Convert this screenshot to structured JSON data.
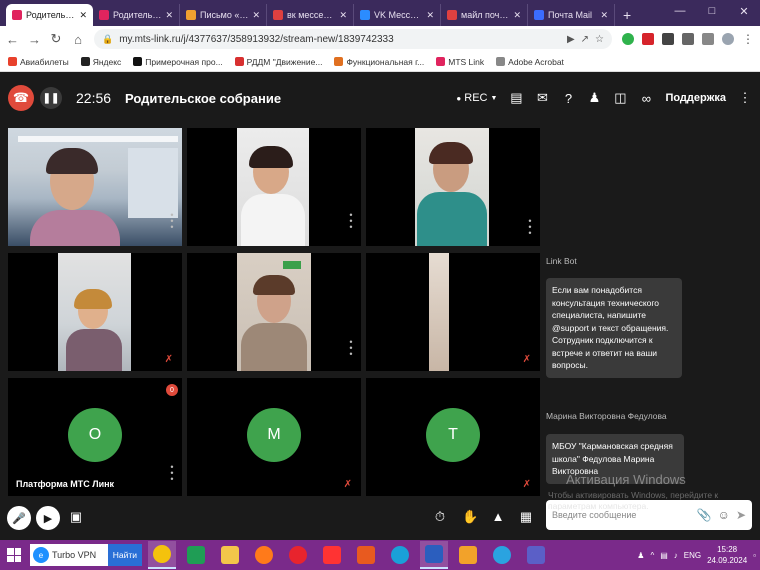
{
  "browser": {
    "tabs": [
      {
        "label": "Родительско",
        "favicon_color": "#e0245e",
        "active": true
      },
      {
        "label": "Родительское с",
        "favicon_color": "#e0245e",
        "active": false
      },
      {
        "label": "Письмо «(Без т",
        "favicon_color": "#f0a030",
        "active": false
      },
      {
        "label": "вк мессенджер",
        "favicon_color": "#e04040",
        "active": false
      },
      {
        "label": "VK Мессендже",
        "favicon_color": "#2b8cff",
        "active": false
      },
      {
        "label": "майл почта —",
        "favicon_color": "#e04040",
        "active": false
      },
      {
        "label": "Почта Mail",
        "favicon_color": "#3b6cff",
        "active": false
      }
    ],
    "new_tab_label": "+",
    "url": "my.mts-link.ru/j/4377637/358913932/stream-new/1839742333",
    "bookmarks": [
      {
        "label": "Авиабилеты",
        "color": "#e8412c"
      },
      {
        "label": "Яндекс",
        "color": "#222222"
      },
      {
        "label": "Примерочная про...",
        "color": "#111111"
      },
      {
        "label": "РДДМ \"Движение...",
        "color": "#d83030"
      },
      {
        "label": "Функциональная г...",
        "color": "#e07020"
      },
      {
        "label": "MTS Link",
        "color": "#e0245e"
      },
      {
        "label": "Adobe Acrobat",
        "color": "#888888"
      }
    ]
  },
  "meeting": {
    "timer": "22:56",
    "title": "Родительское собрание",
    "rec_label": "REC",
    "support_label": "Поддержка",
    "participants": [
      {
        "name": "Платформа МТС Линк",
        "initial": "O"
      },
      {
        "name": "",
        "initial": "M"
      },
      {
        "name": "",
        "initial": "T"
      }
    ],
    "badge_count": "0"
  },
  "chat": {
    "messages": [
      {
        "sender": "Link Bot",
        "text": "Если вам понадобится консультация технического специалиста, напишите @support и текст обращения. Сотрудник подключится к встрече и ответит на ваши вопросы."
      },
      {
        "sender": "Марина Викторовна Федулова",
        "text": "МБОУ \"Кармановская средняя школа\" Федулова Марина Викторовна"
      }
    ],
    "input_placeholder": "Введите сообщение"
  },
  "watermark": {
    "line1": "Активация Windows",
    "line2": "Чтобы активировать Windows, перейдите к параметрам компьютера."
  },
  "taskbar": {
    "search_text": "Turbo VPN",
    "search_button": "Найти",
    "lang": "ENG",
    "time": "15:28",
    "date": "24.09.2024",
    "apps": [
      {
        "name": "chrome",
        "color": "#f4c20d",
        "active": true
      },
      {
        "name": "excel",
        "color": "#1f9d55",
        "active": false
      },
      {
        "name": "explorer",
        "color": "#f3c64a",
        "active": false
      },
      {
        "name": "firefox",
        "color": "#ff7a1a",
        "active": false
      },
      {
        "name": "opera",
        "color": "#e8242d",
        "active": false
      },
      {
        "name": "yandex",
        "color": "#ff3333",
        "active": false
      },
      {
        "name": "app-orange",
        "color": "#e85a1f",
        "active": false
      },
      {
        "name": "edge",
        "color": "#1aa0d8",
        "active": false
      },
      {
        "name": "word",
        "color": "#2b5ebe",
        "active": true
      },
      {
        "name": "video",
        "color": "#f2a22a",
        "active": false
      },
      {
        "name": "telegram",
        "color": "#2aa3e0",
        "active": false
      },
      {
        "name": "teams",
        "color": "#5b5fc7",
        "active": false
      }
    ]
  },
  "colors": {
    "accent_red": "#e04a3b",
    "avatar_green": "#3fa34d",
    "app_bg": "#1a1a1a",
    "tile_bg": "#000000"
  }
}
